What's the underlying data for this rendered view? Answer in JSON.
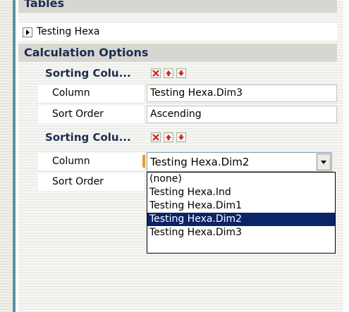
{
  "sections": {
    "tables_header": "Tables",
    "calc_header": "Calculation Options"
  },
  "tables": {
    "item_label": "Testing Hexa"
  },
  "sorting": [
    {
      "title": "Sorting Colu...",
      "column_label": "Column",
      "column_value": "Testing Hexa.Dim3",
      "order_label": "Sort Order",
      "order_value": "Ascending"
    },
    {
      "title": "Sorting Colu...",
      "column_label": "Column",
      "column_value": "Testing Hexa.Dim2",
      "order_label": "Sort Order"
    }
  ],
  "dropdown": {
    "options": [
      "(none)",
      "Testing Hexa.Ind",
      "Testing Hexa.Dim1",
      "Testing Hexa.Dim2",
      "Testing Hexa.Dim3"
    ],
    "selected_index": 3
  },
  "colors": {
    "header_text": "#1d2d52",
    "delete_icon": "#d21f1f",
    "arrow_icon": "#d21f1f",
    "selection": "#0a246a",
    "current_marker": "#e89c2a"
  }
}
